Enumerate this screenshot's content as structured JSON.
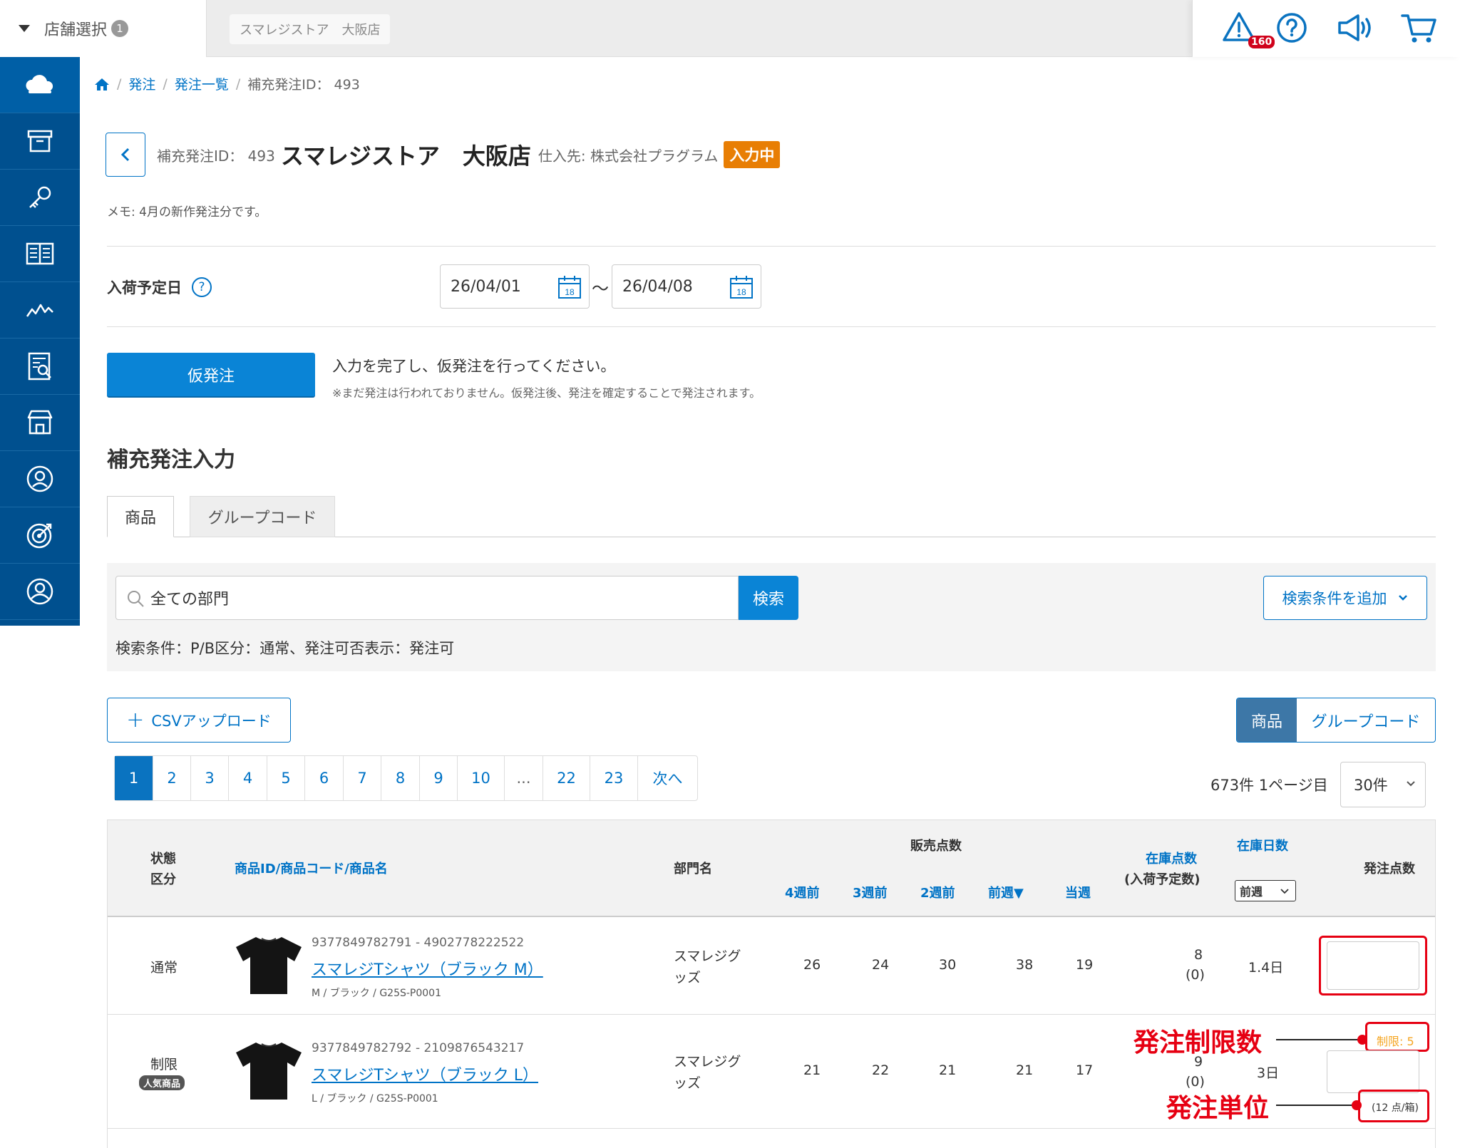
{
  "topbar": {
    "store_select_label": "店舗選択",
    "store_select_count": "1",
    "current_store": "スマレジストア　大阪店",
    "alert_count": "160"
  },
  "breadcrumb": {
    "items": [
      "発注",
      "発注一覧"
    ],
    "current": "補充発注ID： 493"
  },
  "header": {
    "id_label": "補充発注ID： 493",
    "store_name": "スマレジストア　大阪店",
    "supplier": "仕入先: 株式会社プラグラム",
    "status": "入力中",
    "memo": "メモ: 4月の新作発注分です。"
  },
  "arrival": {
    "label": "入荷予定日",
    "help": "?",
    "from": "26/04/01",
    "to": "26/04/08",
    "separator": "〜",
    "calendar_day": "18"
  },
  "provisional": {
    "button": "仮発注",
    "message": "入力を完了し、仮発注を行ってください。",
    "note": "※まだ発注は行われておりません。仮発注後、発注を確定することで発注されます。"
  },
  "section_title": "補充発注入力",
  "tabs": [
    "商品",
    "グループコード"
  ],
  "search": {
    "value": "全ての部門",
    "button": "検索",
    "add_condition": "検索条件を追加",
    "conditions": "検索条件：P/B区分：通常、発注可否表示：発注可"
  },
  "csv_upload": "CSVアップロード",
  "view_toggle": [
    "商品",
    "グループコード"
  ],
  "pagination": {
    "pages": [
      "1",
      "2",
      "3",
      "4",
      "5",
      "6",
      "7",
      "8",
      "9",
      "10",
      "...",
      "22",
      "23",
      "次へ"
    ],
    "current": "1",
    "summary": "673件 1ページ目",
    "per_page": "30件"
  },
  "table": {
    "headers": {
      "status": "状態",
      "category": "区分",
      "product_id": "商品ID",
      "product_code": "/商品コード",
      "product_name": "/商品名",
      "department": "部門名",
      "sales": "販売点数",
      "w4": "4週前",
      "w3": "3週前",
      "w2": "2週前",
      "lastweek": "前週▼",
      "thisweek": "当週",
      "stock": "在庫点数",
      "stock_sub": "(入荷予定数)",
      "stock_days": "在庫日数",
      "stock_days_select": "前週",
      "order_qty": "発注点数"
    },
    "rows": [
      {
        "status": "通常",
        "badge": "",
        "ids": "9377849782791 - 4902778222522",
        "name": "スマレジTシャツ（ブラック M）",
        "variant": "M / ブラック / G25S-P0001",
        "department": "スマレジグッズ",
        "w4": "26",
        "w3": "24",
        "w2": "30",
        "lastweek": "38",
        "thisweek": "19",
        "stock": "8",
        "incoming": "(0)",
        "days": "1.4日",
        "limit": "",
        "unit": ""
      },
      {
        "status": "制限",
        "badge": "人気商品",
        "ids": "9377849782792 - 2109876543217",
        "name": "スマレジTシャツ（ブラック L）",
        "variant": "L / ブラック / G25S-P0001",
        "department": "スマレジグッズ",
        "w4": "21",
        "w3": "22",
        "w2": "21",
        "lastweek": "21",
        "thisweek": "17",
        "stock": "9",
        "incoming": "(0)",
        "days": "3日",
        "limit": "制限: 5",
        "unit": "(12 点/箱)"
      }
    ]
  },
  "annotations": {
    "limit_label": "発注制限数",
    "unit_label": "発注単位"
  },
  "colors": {
    "sidebar": "#00508f",
    "primary": "#0a84d6",
    "link": "#0073c6",
    "status_badge": "#e87e04",
    "annotation": "#e60012"
  }
}
